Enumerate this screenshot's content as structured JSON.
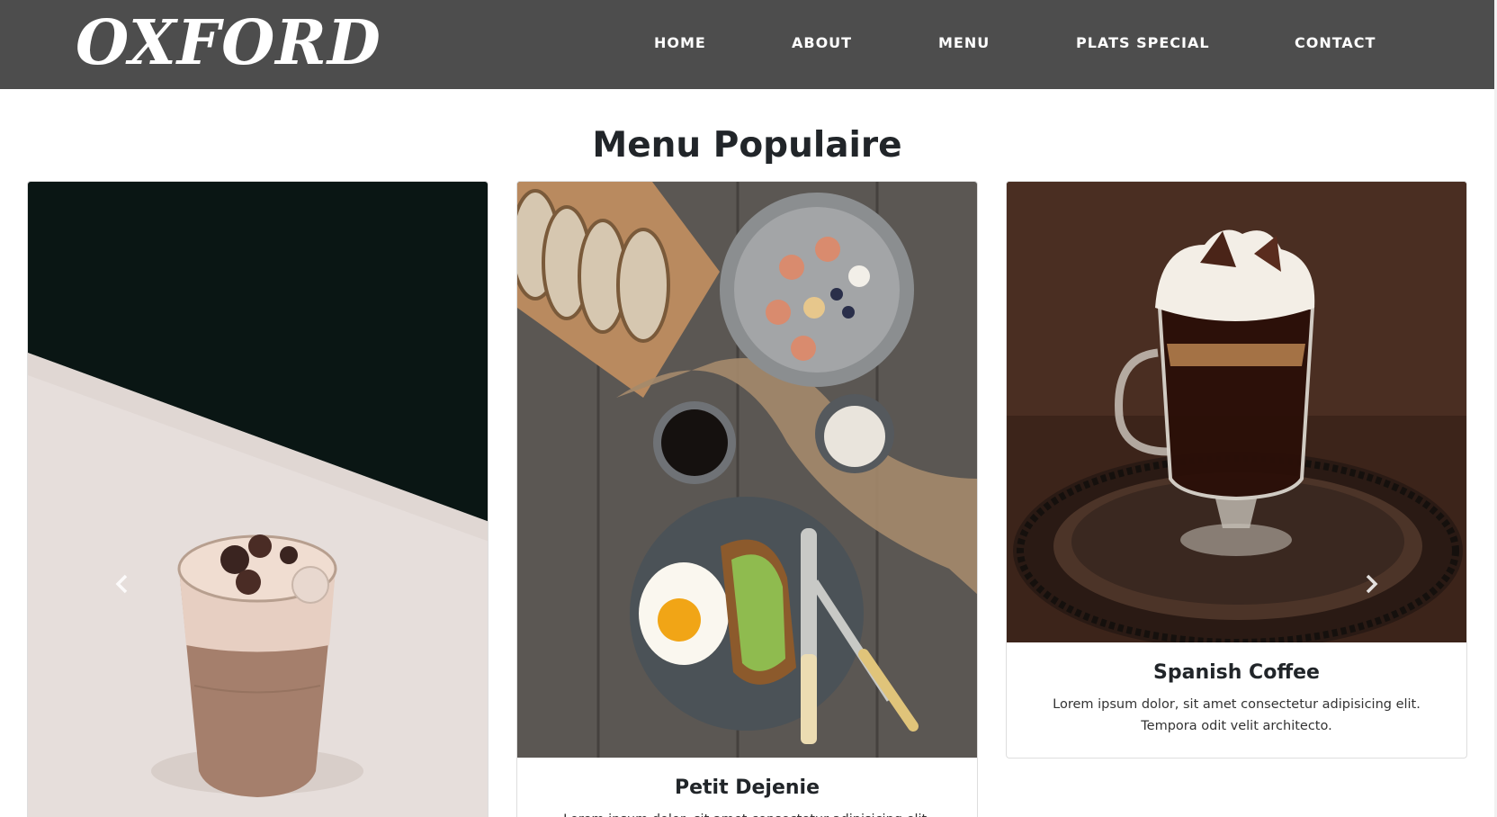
{
  "navbar": {
    "logo": "OXFORD",
    "links": [
      {
        "label": "HOME"
      },
      {
        "label": "ABOUT"
      },
      {
        "label": "MENU"
      },
      {
        "label": "PLATS SPECIAL"
      },
      {
        "label": "CONTACT"
      }
    ]
  },
  "section": {
    "title": "Menu Populaire"
  },
  "cards": [
    {
      "title": "",
      "text": "",
      "image": "iced-coffee-photo"
    },
    {
      "title": "Petit Dejenie",
      "text": "Lorem ipsum dolor, sit amet consectetur adipisicing elit.",
      "image": "breakfast-table-photo"
    },
    {
      "title": "Spanish Coffee",
      "text": "Lorem ipsum dolor, sit amet consectetur adipisicing elit. Tempora odit velit architecto.",
      "image": "irish-coffee-glass-photo"
    }
  ],
  "carousel": {
    "prev_icon": "chevron-left-icon",
    "next_icon": "chevron-right-icon"
  },
  "colors": {
    "navbar_bg": "#4d4d4d",
    "nav_text": "#ffffff",
    "page_bg": "#ffffff",
    "title_text": "#212529"
  }
}
